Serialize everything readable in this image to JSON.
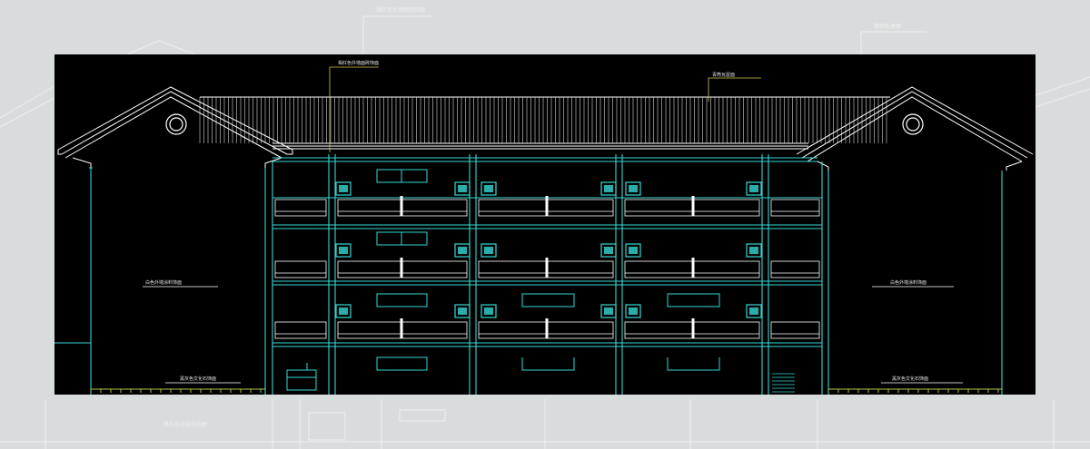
{
  "drawing": {
    "colors": {
      "page_background": "#d9dcdc",
      "canvas_background": "#000000",
      "structure_line": "#35d7d3",
      "roof_line": "#ffffff",
      "leader_line": "#d4c34a",
      "ground_hatch": "#b6c24a"
    },
    "annotations": {
      "top_center": "褐红色外墙面砖饰面",
      "top_right": "青筒瓦屋面",
      "left_wall": "白色外墙涂料饰面",
      "right_wall": "白色外墙涂料饰面",
      "left_base": "黑灰色文化石饰面",
      "right_base": "黑灰色文化石饰面"
    },
    "background_labels": {
      "top_center": "褐红色外墙面砖饰面",
      "top_right": "青筒瓦屋面",
      "bottom_left": "黑灰色文化石饰面"
    },
    "icons": [
      "gable-vent-icon",
      "railing-ornament-icon"
    ]
  }
}
